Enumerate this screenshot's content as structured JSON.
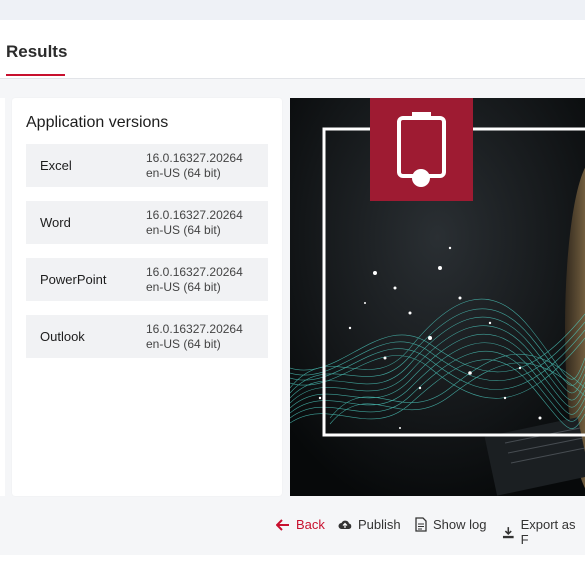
{
  "header": {
    "tab_label": "Results"
  },
  "app_versions": {
    "title": "Application versions",
    "items": [
      {
        "name": "Excel",
        "version": "16.0.16327.20264",
        "locale": "en-US (64 bit)"
      },
      {
        "name": "Word",
        "version": "16.0.16327.20264",
        "locale": "en-US (64 bit)"
      },
      {
        "name": "PowerPoint",
        "version": "16.0.16327.20264",
        "locale": "en-US (64 bit)"
      },
      {
        "name": "Outlook",
        "version": "16.0.16327.20264",
        "locale": "en-US (64 bit)"
      }
    ]
  },
  "footer": {
    "back": "Back",
    "publish": "Publish",
    "show_log": "Show log",
    "export": "Export as F"
  },
  "colors": {
    "accent": "#c8102e",
    "brand_tile": "#9e1b32",
    "wave": "#4fd1c5"
  },
  "icons": [
    "battery-icon",
    "arrow-left-icon",
    "cloud-upload-icon",
    "document-icon",
    "download-icon"
  ]
}
